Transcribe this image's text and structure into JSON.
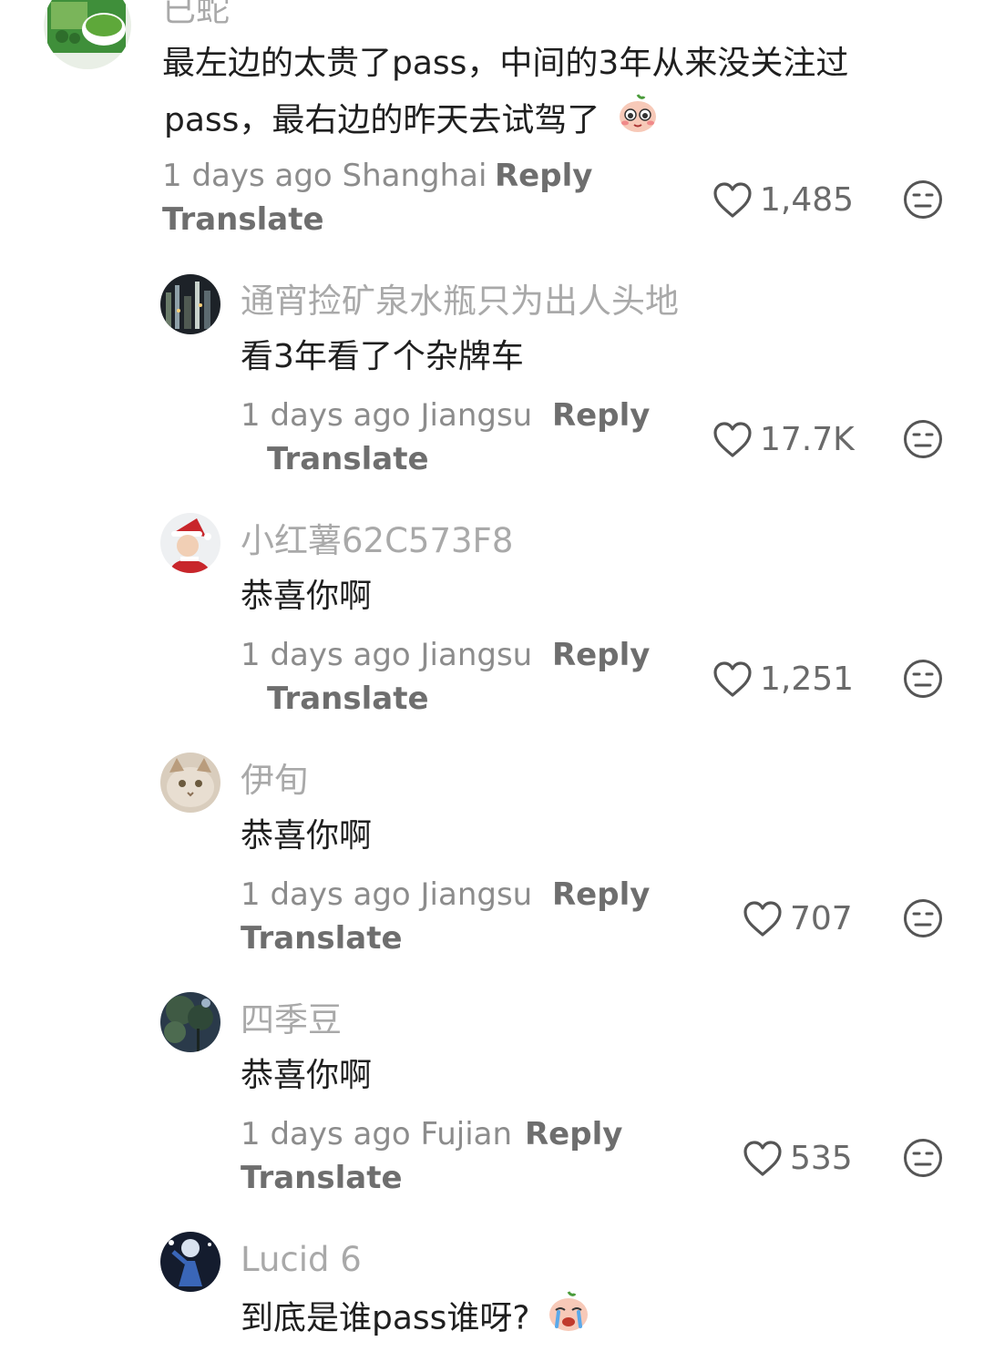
{
  "comments": [
    {
      "username": "已蛇",
      "text_line1": "最左边的太贵了pass，中间的3年从来没关注过",
      "text_line2": "pass，最右边的昨天去试驾了",
      "time": "1 days ago",
      "location": "Shanghai",
      "reply_label": "Reply",
      "translate_label": "Translate",
      "likes": "1,485",
      "avatar_icon": "food-package-avatar"
    },
    {
      "username": "通宵捡矿泉水瓶只为出人头地",
      "text": "看3年看了个杂牌车",
      "time": "1 days ago",
      "location": "Jiangsu",
      "reply_label": "Reply",
      "translate_label": "Translate",
      "likes": "17.7K",
      "avatar_icon": "night-city-avatar"
    },
    {
      "username": "小红薯62C573F8",
      "text": "恭喜你啊",
      "time": "1 days ago",
      "location": "Jiangsu",
      "reply_label": "Reply",
      "translate_label": "Translate",
      "likes": "1,251",
      "avatar_icon": "santa-avatar"
    },
    {
      "username": "伊旬",
      "text": "恭喜你啊",
      "time": "1 days ago",
      "location": "Jiangsu",
      "reply_label": "Reply",
      "translate_label": "Translate",
      "likes": "707",
      "avatar_icon": "cat-avatar"
    },
    {
      "username": "四季豆",
      "text": "恭喜你啊",
      "time": "1 days ago",
      "location": "Fujian",
      "reply_label": "Reply",
      "translate_label": "Translate",
      "likes": "535",
      "avatar_icon": "tree-avatar"
    },
    {
      "username": "Lucid 6",
      "text": "到底是谁pass谁呀?",
      "avatar_icon": "sports-avatar"
    }
  ],
  "colors": {
    "username": "#a9a9a9",
    "text": "#1f1f1f",
    "meta": "#8c8c8c",
    "action": "#6e6e6e"
  }
}
